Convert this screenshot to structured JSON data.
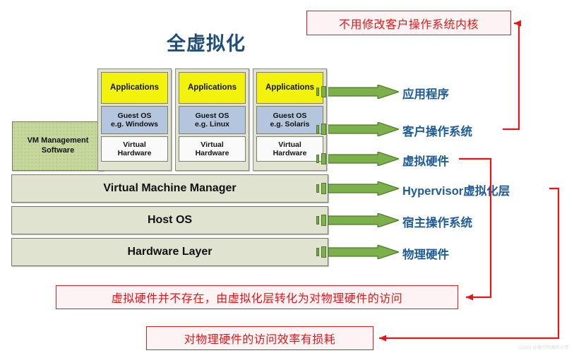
{
  "title": "全虚拟化",
  "colors": {
    "title_blue": "#1f4e79",
    "label_blue": "#1f5c99",
    "annotation_red": "#e01818",
    "arrow_green": "#7cb04a",
    "layer_fill": "#e0e3d0",
    "app_fill": "#f2f20d",
    "guest_os_fill": "#b3c6de",
    "virtual_hw_fill": "#fafafa",
    "vm_mgmt_fill": "#c6d79c"
  },
  "vm_management": {
    "line1": "VM Management",
    "line2": "Software"
  },
  "vms": [
    {
      "applications": "Applications",
      "guest_os_line1": "Guest OS",
      "guest_os_line2": "e.g. Windows",
      "virtual_hw_line1": "Virtual",
      "virtual_hw_line2": "Hardware"
    },
    {
      "applications": "Applications",
      "guest_os_line1": "Guest OS",
      "guest_os_line2": "e.g. Linux",
      "virtual_hw_line1": "Virtual",
      "virtual_hw_line2": "Hardware"
    },
    {
      "applications": "Applications",
      "guest_os_line1": "Guest OS",
      "guest_os_line2": "e.g. Solaris",
      "virtual_hw_line1": "Virtual",
      "virtual_hw_line2": "Hardware"
    }
  ],
  "layers": [
    {
      "label": "Virtual Machine Manager"
    },
    {
      "label": "Host OS"
    },
    {
      "label": "Hardware Layer"
    }
  ],
  "right_labels": [
    {
      "text": "应用程序"
    },
    {
      "text": "客户操作系统"
    },
    {
      "text": "虚拟硬件"
    },
    {
      "text": "Hypervisor虚拟化层"
    },
    {
      "text": "宿主操作系统"
    },
    {
      "text": "物理硬件"
    }
  ],
  "annotations": [
    {
      "text": "不用修改客户操作系统内核"
    },
    {
      "text": "虚拟硬件并不存在，由虚拟化层转化为对物理硬件的访问"
    },
    {
      "text": "对物理硬件的访问效率有损耗"
    }
  ],
  "watermark": "CSDN @搬代码搬的小学"
}
